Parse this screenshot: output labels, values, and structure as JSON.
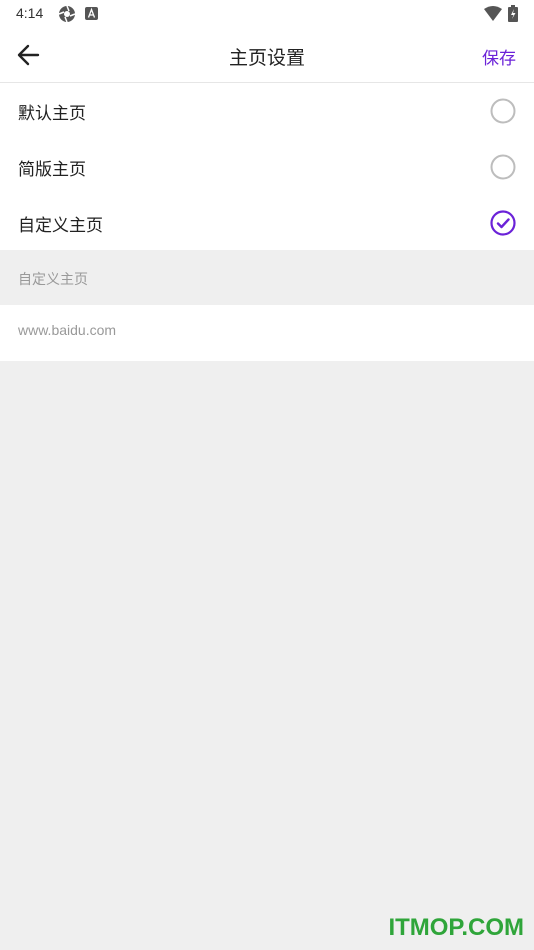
{
  "status_bar": {
    "time": "4:14"
  },
  "toolbar": {
    "title": "主页设置",
    "save_label": "保存"
  },
  "options": [
    {
      "label": "默认主页",
      "selected": false
    },
    {
      "label": "简版主页",
      "selected": false
    },
    {
      "label": "自定义主页",
      "selected": true
    }
  ],
  "custom_section": {
    "header": "自定义主页",
    "url_value": "www.baidu.com"
  },
  "watermark": "ITMOP.COM",
  "colors": {
    "accent": "#6b22d8",
    "radio_unchecked": "#bdbdbd",
    "watermark": "#2fa53a"
  }
}
